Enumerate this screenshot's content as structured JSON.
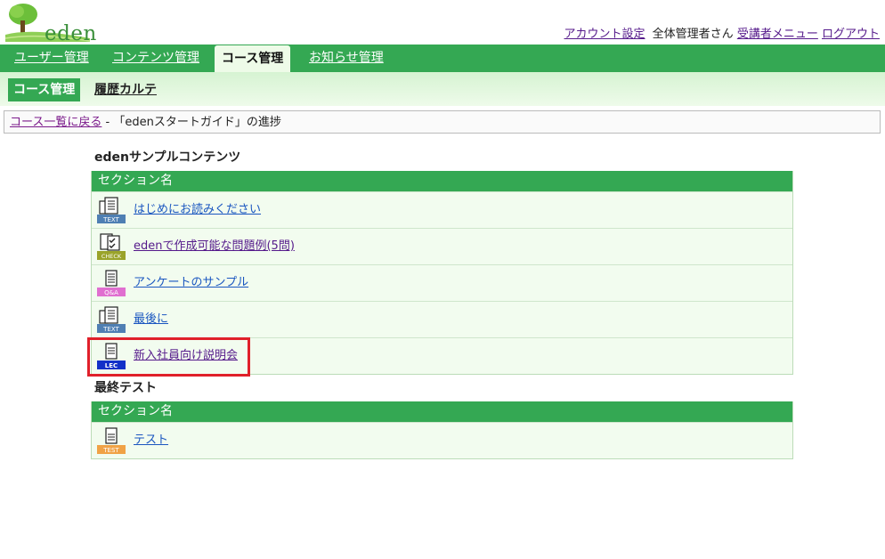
{
  "brand": {
    "name": "eden"
  },
  "top_links": {
    "account_settings": "アカウント設定",
    "user_name": "全体管理者さん",
    "learner_menu": "受講者メニュー",
    "logout": "ログアウト"
  },
  "nav": {
    "tabs": [
      {
        "label": "ユーザー管理",
        "active": false
      },
      {
        "label": "コンテンツ管理",
        "active": false
      },
      {
        "label": "コース管理",
        "active": true
      },
      {
        "label": "お知らせ管理",
        "active": false
      }
    ]
  },
  "subnav": {
    "active_label": "コース管理",
    "history_label": "履歴カルテ"
  },
  "breadcrumb": {
    "back_link": "コース一覧に戻る",
    "separator": " - ",
    "current": "「edenスタートガイド」の進捗"
  },
  "groups": [
    {
      "title": "edenサンプルコンテンツ",
      "column_header": "セクション名",
      "items": [
        {
          "label": "はじめにお読みください",
          "icon": "text-doc-icon",
          "badge": "TEXT",
          "color": "#4f7fb3",
          "visited": false
        },
        {
          "label": "edenで作成可能な問題例(5問)",
          "icon": "check-quiz-icon",
          "badge": "CHECK",
          "color": "#9aa32a",
          "visited": true
        },
        {
          "label": "アンケートのサンプル",
          "icon": "survey-icon",
          "badge": "Q&A",
          "color": "#e06fd0",
          "visited": false
        },
        {
          "label": "最後に",
          "icon": "text-doc-icon",
          "badge": "TEXT",
          "color": "#4f7fb3",
          "visited": false
        },
        {
          "label": "新入社員向け説明会",
          "icon": "lecture-icon",
          "badge": "LEC",
          "color": "#1230c8",
          "visited": true
        }
      ]
    },
    {
      "title": "最終テスト",
      "column_header": "セクション名",
      "items": [
        {
          "label": "テスト",
          "icon": "test-icon",
          "badge": "TEST",
          "color": "#f0a246",
          "visited": false
        }
      ]
    }
  ],
  "colors": {
    "nav_green": "#34a853",
    "highlight_red": "#e0202a"
  }
}
